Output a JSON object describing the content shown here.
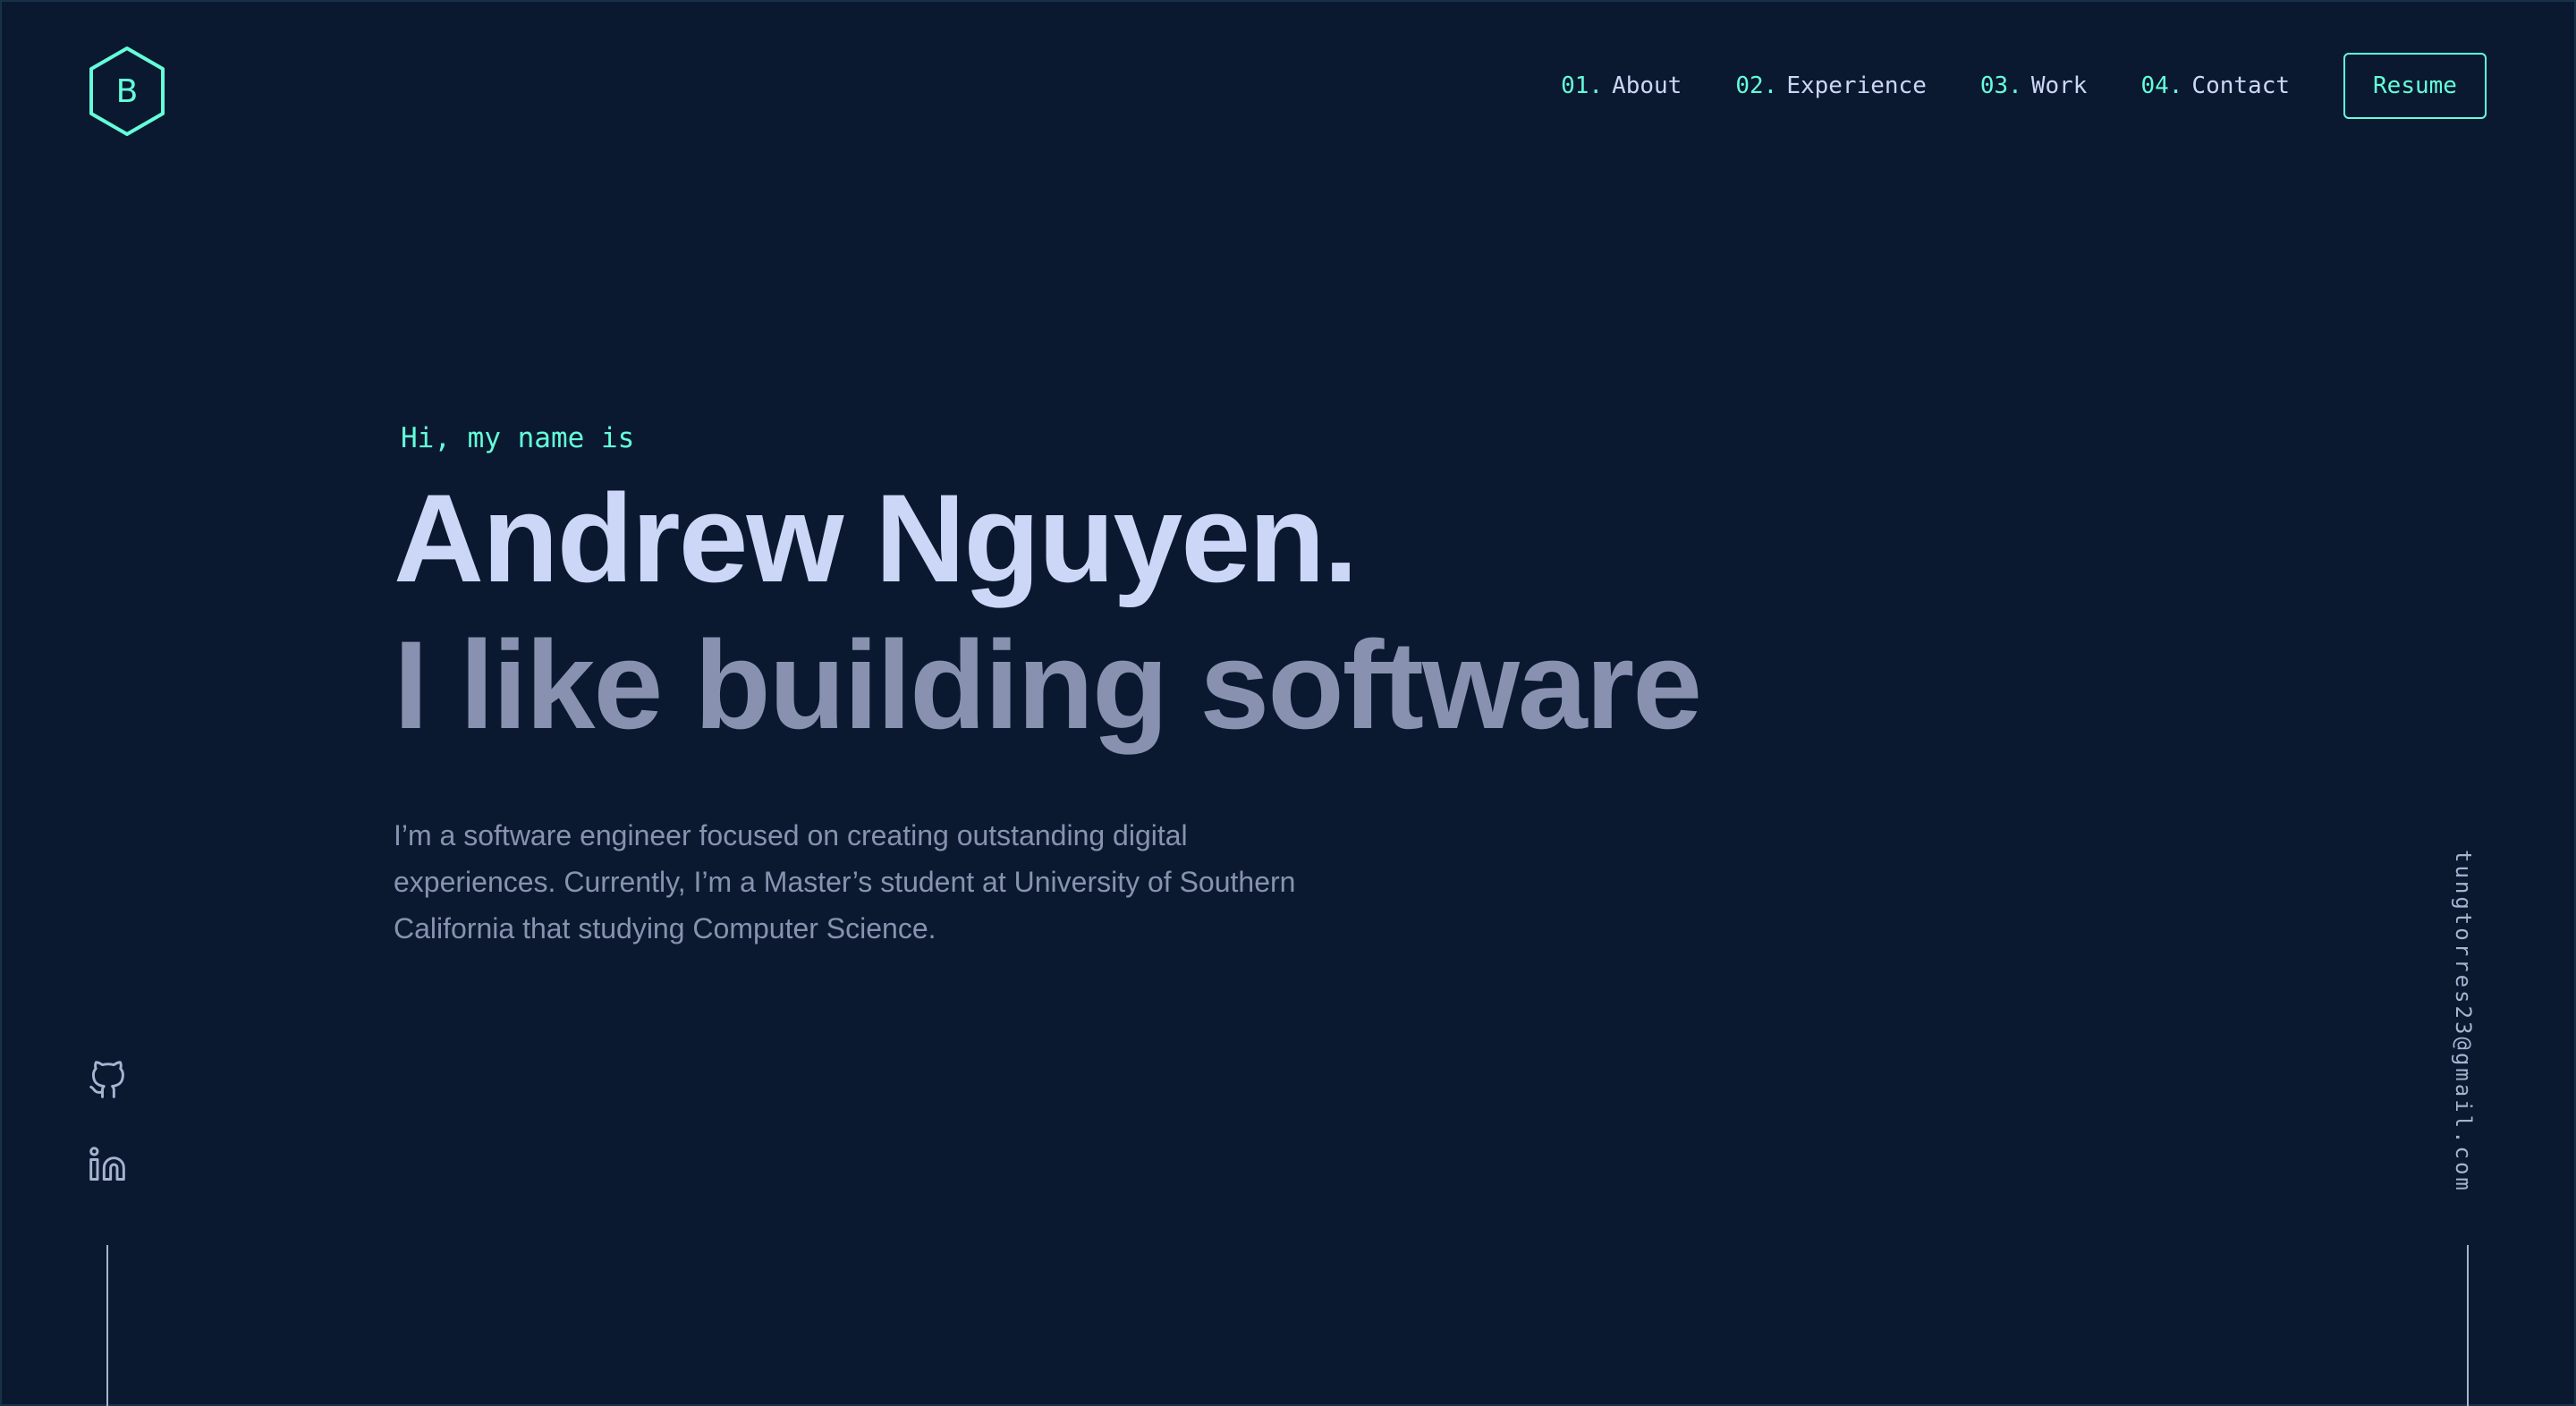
{
  "logo": {
    "letter": "B",
    "icon": "hexagon-logo-icon"
  },
  "nav": {
    "items": [
      {
        "num": "01.",
        "label": "About"
      },
      {
        "num": "02.",
        "label": "Experience"
      },
      {
        "num": "03.",
        "label": "Work"
      },
      {
        "num": "04.",
        "label": "Contact"
      }
    ],
    "resume_label": "Resume"
  },
  "hero": {
    "greeting": "Hi, my name is",
    "name": "Andrew Nguyen.",
    "tagline": "I like building software",
    "bio": "I’m a software engineer focused on creating outstanding digital experiences. Currently, I’m a Master’s student at University of Southern California that studying Computer Science."
  },
  "social": {
    "icons": [
      "github-icon",
      "linkedin-icon"
    ]
  },
  "email": "tungtorres23@gmail.com",
  "colors": {
    "background": "#0b1930",
    "accent": "#64ffda",
    "heading": "#ccd6f6",
    "muted": "#8892b0",
    "light": "#a8b2d1"
  }
}
